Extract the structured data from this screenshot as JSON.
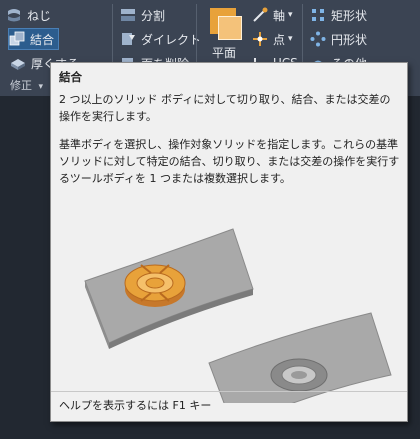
{
  "ribbon": {
    "modify": {
      "twist_label": "ねじ",
      "union_label": "結合",
      "thicken_label": "厚くする",
      "panel_label": "修正"
    },
    "section": {
      "split_label": "分割",
      "direct_label": "ダイレクト",
      "delete_label": "面を削除"
    },
    "plane": {
      "big_label": "平面"
    },
    "ucs": {
      "axis_label": "軸",
      "point_label": "点",
      "ucs_label": "UCS"
    },
    "shapes": {
      "rect_label": "矩形状",
      "circle_label": "円形状",
      "more_label": "その他"
    }
  },
  "tooltip": {
    "title": "結合",
    "desc1": "2 つ以上のソリッド ボディに対して切り取り、結合、または交差の操作を実行します。",
    "desc2": "基準ボディを選択し、操作対象ソリッドを指定します。これらの基準ソリッドに対して特定の結合、切り取り、または交差の操作を実行するツールボディを 1 つまたは複数選択します。",
    "footer": "ヘルプを表示するには F1 キー"
  },
  "colors": {
    "ribbon_bg": "#3b4453",
    "active_button": "#2c5d8e",
    "tooltip_bg": "#f0f0f0",
    "tool_body": "#e8a23a"
  }
}
